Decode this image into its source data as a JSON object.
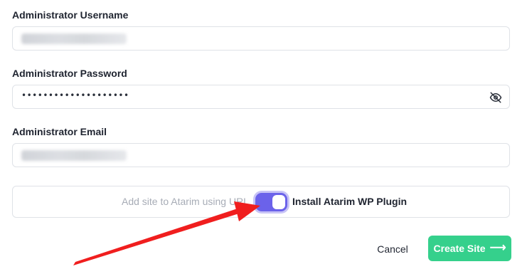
{
  "form": {
    "username": {
      "label": "Administrator Username"
    },
    "password": {
      "label": "Administrator Password",
      "masked_value": "••••••••••••••••••••",
      "toggle_icon": "eye-off-icon"
    },
    "email": {
      "label": "Administrator Email"
    }
  },
  "install_option": {
    "left_label": "Add site to Atarim using URL",
    "right_label": "Install Atarim WP Plugin",
    "toggle_state": "on",
    "toggle_color": "#6b62ea"
  },
  "actions": {
    "cancel_label": "Cancel",
    "create_label": "Create Site",
    "create_icon": "⟶",
    "create_color": "#35d08c"
  },
  "annotation": {
    "arrow_color": "#f01e1e"
  }
}
